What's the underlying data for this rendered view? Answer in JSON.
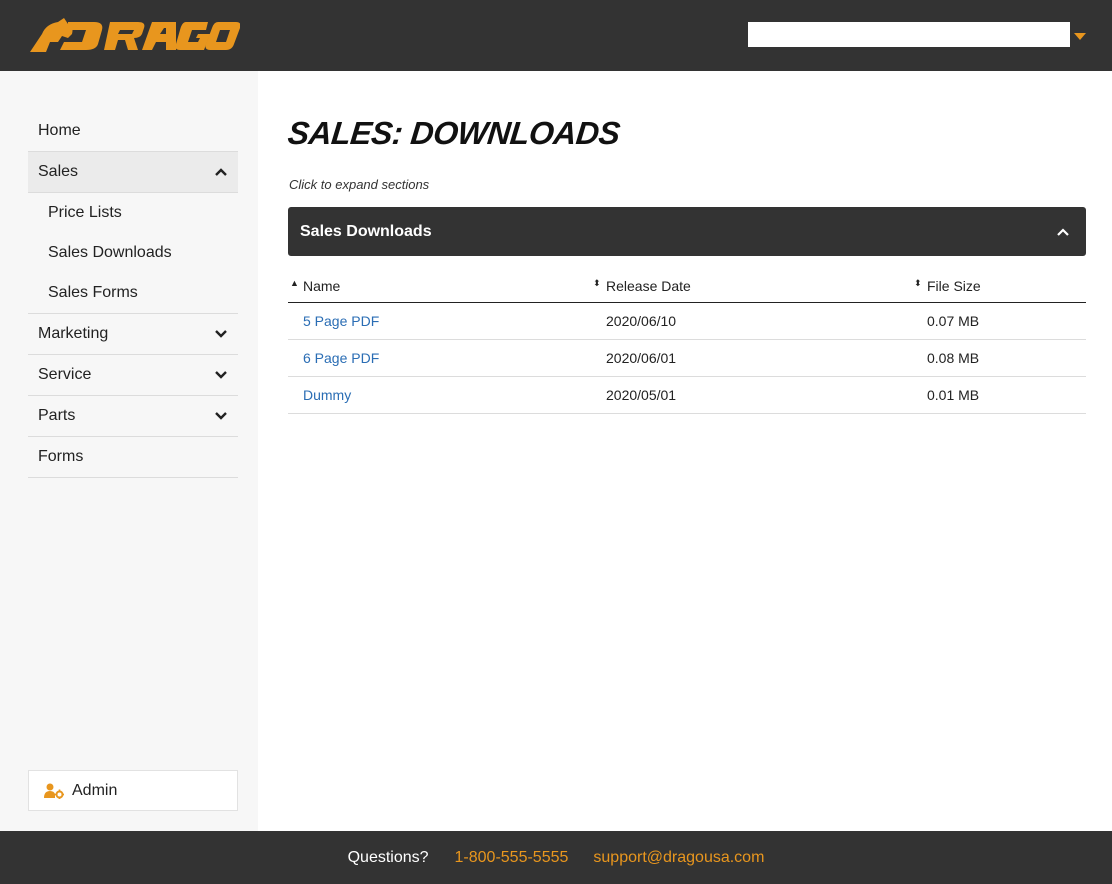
{
  "header": {
    "logo_text": "DRAGO",
    "search_value": "",
    "brand_color": "#e8961e"
  },
  "sidebar": {
    "items": [
      {
        "label": "Home"
      },
      {
        "label": "Sales",
        "expanded": true,
        "children": [
          {
            "label": "Price Lists"
          },
          {
            "label": "Sales Downloads"
          },
          {
            "label": "Sales Forms"
          }
        ]
      },
      {
        "label": "Marketing",
        "expanded": false
      },
      {
        "label": "Service",
        "expanded": false
      },
      {
        "label": "Parts",
        "expanded": false
      },
      {
        "label": "Forms"
      }
    ],
    "admin_label": "Admin"
  },
  "main": {
    "title": "SALES: DOWNLOADS",
    "hint": "Click to expand sections",
    "panel_title": "Sales Downloads",
    "table": {
      "headers": [
        "Name",
        "Release Date",
        "File Size"
      ],
      "rows": [
        {
          "name": "5 Page PDF",
          "date": "2020/06/10",
          "size": "0.07 MB"
        },
        {
          "name": "6 Page PDF",
          "date": "2020/06/01",
          "size": "0.08 MB"
        },
        {
          "name": "Dummy",
          "date": "2020/05/01",
          "size": "0.01 MB"
        }
      ]
    }
  },
  "footer": {
    "questions": "Questions?",
    "phone": "1-800-555-5555",
    "email": "support@dragousa.com"
  }
}
